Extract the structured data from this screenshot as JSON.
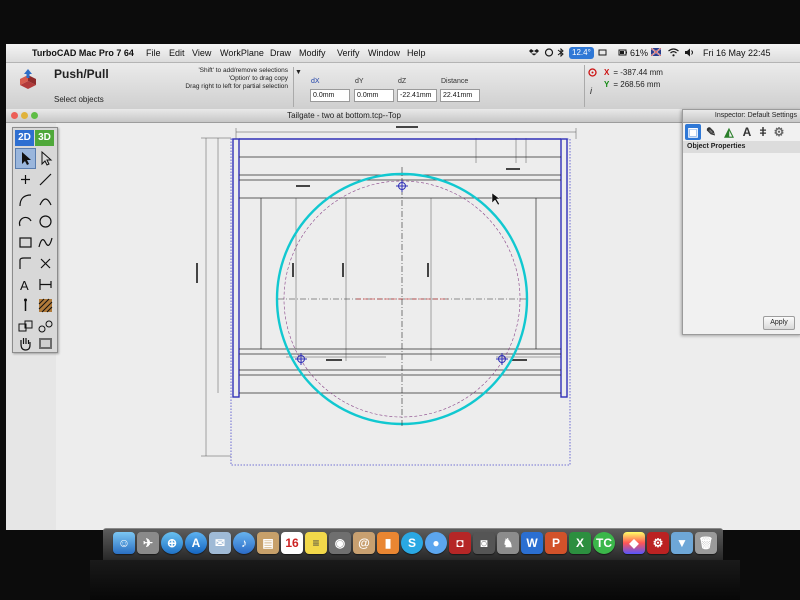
{
  "menubar": {
    "apple": "",
    "app_title": "TurboCAD Mac Pro 7 64",
    "items": [
      "File",
      "Edit",
      "View",
      "WorkPlane",
      "Draw",
      "Modify",
      "Verify",
      "Window",
      "Help"
    ],
    "temperature": "12.4°",
    "battery": "61%",
    "clock": "Fri 16 May  22:45"
  },
  "toolbar": {
    "tool_name": "Push/Pull",
    "status": "Select objects",
    "hints": [
      "'Shift' to add/remove selections",
      "'Option' to drag copy",
      "Drag right to left for partial selection"
    ],
    "fields": [
      {
        "label": "dX",
        "value": "0.0mm"
      },
      {
        "label": "dY",
        "value": "0.0mm"
      },
      {
        "label": "dZ",
        "value": "-22.41mm"
      },
      {
        "label": "Distance",
        "value": "22.41mm"
      }
    ],
    "coords": {
      "x_label": "X",
      "x_value": "= -387.44 mm",
      "y_label": "Y",
      "y_value": "= 268.56 mm"
    }
  },
  "document": {
    "title": "Tailgate - two at bottom.tcp--Top"
  },
  "palette": {
    "mode_2d": "2D",
    "mode_3d": "3D",
    "tools": [
      "select-arrow",
      "select-edit",
      "point",
      "line",
      "arc-three-point",
      "arc",
      "circle-arc",
      "circle",
      "rectangle",
      "spline",
      "curve",
      "cross",
      "text",
      "dimension",
      "insert-point",
      "hatch",
      "block",
      "attribute",
      "hand",
      "view-3d"
    ]
  },
  "inspector": {
    "title": "Inspector: Default Settings",
    "section": "Object Properties",
    "apply": "Apply",
    "icons": [
      "cube-icon",
      "pen-icon",
      "layer-icon",
      "text-a-icon",
      "ruler-icon",
      "gear-icon"
    ]
  },
  "dock": {
    "icons": [
      "finder",
      "launchpad",
      "safari",
      "app-store",
      "mail",
      "itunes",
      "preview",
      "calendar",
      "notes",
      "photo",
      "contacts",
      "ibooks",
      "skype",
      "messages",
      "photo-booth",
      "image-capture",
      "word",
      "powerpoint",
      "excel",
      "turbocad",
      "colorsync",
      "system-preferences",
      "downloads",
      "trash"
    ],
    "calendar_day": "16"
  },
  "colors": {
    "wall": "#3030b8",
    "circle": "#11c8d0",
    "dim": "#3a3a3a",
    "center": "#2a2a2a",
    "accent_red": "#cc1111",
    "dock_accent": "#2f78d6"
  }
}
